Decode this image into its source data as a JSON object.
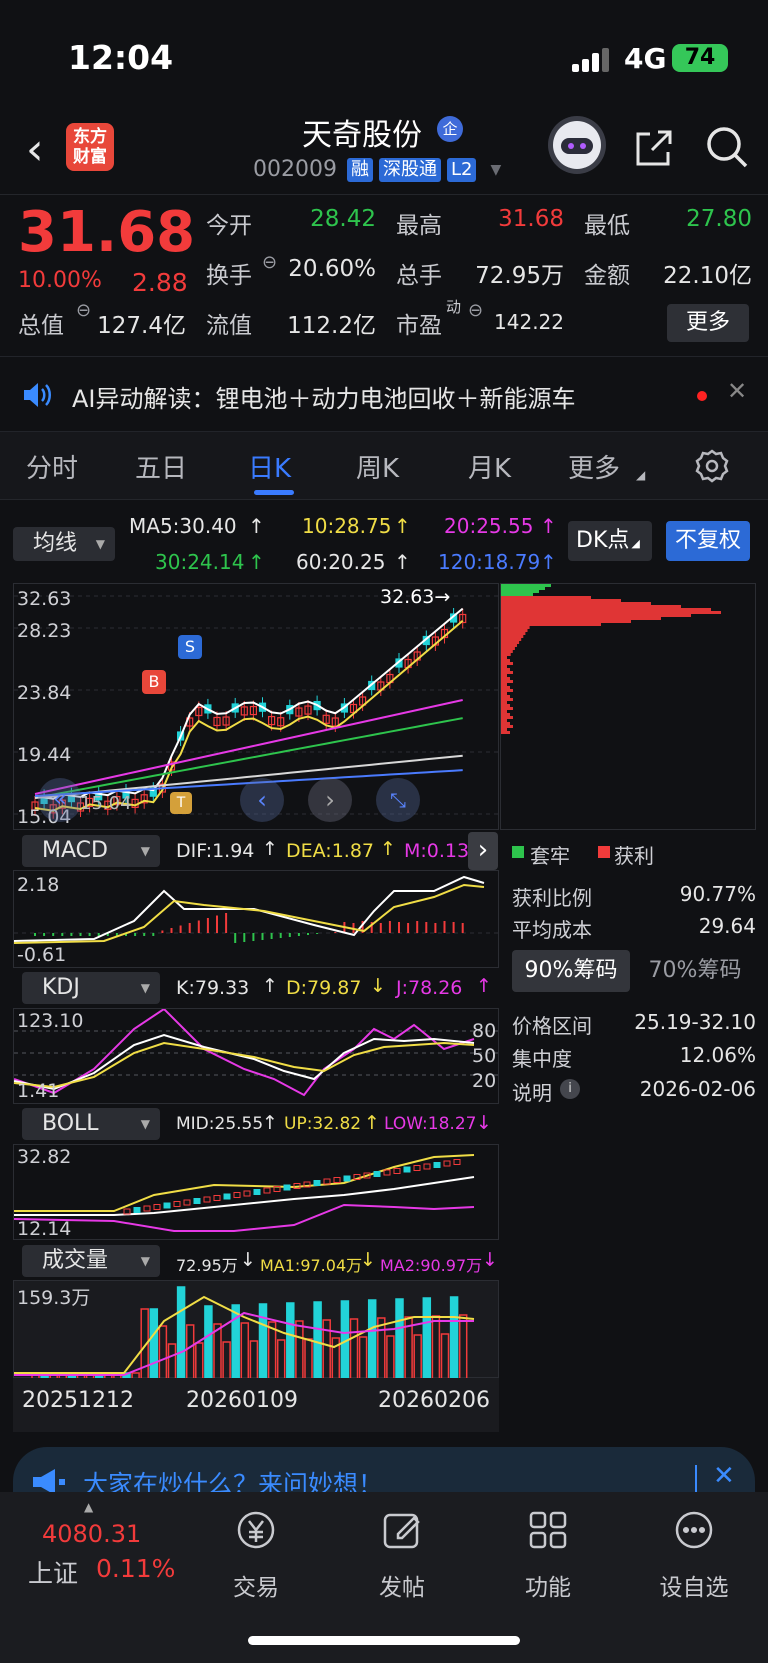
{
  "status_bar": {
    "time": "12:04",
    "network": "4G",
    "battery": "74"
  },
  "header": {
    "stock_name": "天奇股份",
    "ent_badge": "企",
    "code": "002009",
    "tags": [
      "融",
      "深股通",
      "L2"
    ],
    "logo_text": "东方财富"
  },
  "quote": {
    "price": "31.68",
    "change_pct": "10.00%",
    "change": "2.88",
    "open_label": "今开",
    "open": "28.42",
    "high_label": "最高",
    "high": "31.68",
    "low_label": "最低",
    "low": "27.80",
    "turnover_label": "换手",
    "turnover": "20.60%",
    "volume_label": "总手",
    "volume": "72.95万",
    "amount_label": "金额",
    "amount": "22.10亿",
    "mktcap_label": "总值",
    "mktcap": "127.4亿",
    "float_label": "流值",
    "float_cap": "112.2亿",
    "pe_label": "市盈",
    "pe_sup": "动",
    "pe": "142.22",
    "more": "更多"
  },
  "ai_bar": {
    "text": "AI异动解读：锂电池＋动力电池回收＋新能源车"
  },
  "tabs": [
    "分时",
    "五日",
    "日K",
    "周K",
    "月K",
    "更多"
  ],
  "ma": {
    "select": "均线",
    "ma5": "MA5:30.40",
    "ma10": "10:28.75",
    "ma20": "20:25.55",
    "ma30": "30:24.14",
    "ma60": "60:20.25",
    "ma120": "120:18.79",
    "dk": "DK点",
    "fq": "不复权"
  },
  "kline": {
    "axis": [
      "32.63",
      "28.23",
      "23.84",
      "19.44",
      "15.04"
    ],
    "max_label": "32.63→",
    "marker_b": "B",
    "marker_s": "S",
    "marker_t": "T",
    "low_label": "15.04"
  },
  "macd": {
    "select": "MACD",
    "dif": "DIF:1.94",
    "dea": "DEA:1.87",
    "m": "M:0.13",
    "top": "2.18",
    "bottom": "-0.61"
  },
  "kdj": {
    "select": "KDJ",
    "k": "K:79.33",
    "d": "D:79.87",
    "j": "J:78.26",
    "top": "123.10",
    "bottom": "1.41",
    "levels": [
      "80",
      "50",
      "20"
    ]
  },
  "boll": {
    "select": "BOLL",
    "mid": "MID:25.55",
    "up": "UP:32.82",
    "low": "LOW:18.27",
    "top": "32.82",
    "bottom": "12.14"
  },
  "vol": {
    "select": "成交量",
    "vol": "72.95万",
    "ma1": "MA1:97.04万",
    "ma2": "MA2:90.97万",
    "top": "159.3万"
  },
  "dates": [
    "20251212",
    "20260109",
    "20260206"
  ],
  "chips": {
    "legend_trapped": "套牢",
    "legend_profit": "获利",
    "profit_ratio_label": "获利比例",
    "profit_ratio": "90.77%",
    "avg_cost_label": "平均成本",
    "avg_cost": "29.64",
    "btn_90": "90%筹码",
    "btn_70": "70%筹码",
    "range_label": "价格区间",
    "range": "25.19-32.10",
    "concentration_label": "集中度",
    "concentration": "12.06%",
    "note_label": "说明",
    "note": "2026-02-06"
  },
  "ask": {
    "text": "大家在炒什么？来问妙想！"
  },
  "nav": {
    "index_value": "4080.31",
    "index_name": "上证",
    "index_pct": "0.11%",
    "items": [
      "交易",
      "发帖",
      "功能",
      "设自选"
    ]
  },
  "colors": {
    "up": "#f23b3b",
    "down": "#2ec44d",
    "accent": "#2c6ad6",
    "cyan": "#22d3d8"
  }
}
